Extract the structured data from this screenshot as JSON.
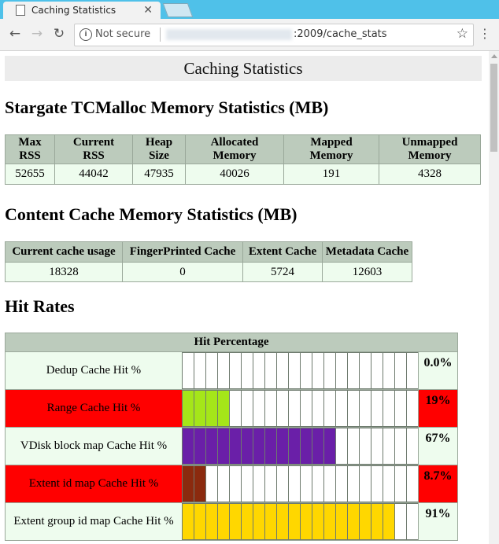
{
  "browser": {
    "tab_title": "Caching Statistics",
    "security_label": "Not secure",
    "url": ":2009/cache_stats"
  },
  "page": {
    "title": "Caching Statistics",
    "tcmalloc": {
      "heading": "Stargate TCMalloc Memory Statistics (MB)",
      "headers": [
        [
          "Max",
          "RSS"
        ],
        [
          "Current",
          "RSS"
        ],
        [
          "Heap",
          "Size"
        ],
        [
          "Allocated",
          "Memory"
        ],
        [
          "Mapped",
          "Memory"
        ],
        [
          "Unmapped",
          "Memory"
        ]
      ],
      "values": [
        "52655",
        "44042",
        "47935",
        "40026",
        "191",
        "4328"
      ]
    },
    "content_cache": {
      "heading": "Content Cache Memory Statistics (MB)",
      "headers": [
        "Current cache usage",
        "FingerPrinted Cache",
        "Extent Cache",
        "Metadata Cache"
      ],
      "values": [
        "18328",
        "0",
        "5724",
        "12603"
      ]
    },
    "hit_rates": {
      "heading": "Hit Rates",
      "column_header": "Hit Percentage",
      "rows": [
        {
          "label": "Dedup Cache Hit %",
          "percent_text": "0.0%",
          "value": 0.0,
          "filled_cells": 0,
          "bar_color": "#ffffff",
          "highlight": false
        },
        {
          "label": "Range Cache Hit %",
          "percent_text": "19%",
          "value": 19,
          "filled_cells": 4,
          "bar_color": "#a5e619",
          "highlight": true
        },
        {
          "label": "VDisk block map Cache Hit %",
          "percent_text": "67%",
          "value": 67,
          "filled_cells": 13,
          "bar_color": "#6a1fa8",
          "highlight": false
        },
        {
          "label": "Extent id map Cache Hit %",
          "percent_text": "8.7%",
          "value": 8.7,
          "filled_cells": 2,
          "bar_color": "#8b2a0e",
          "highlight": true
        },
        {
          "label": "Extent group id map Cache Hit %",
          "percent_text": "91%",
          "value": 91,
          "filled_cells": 18,
          "bar_color": "#ffd700",
          "highlight": false
        }
      ],
      "total_cells": 20
    }
  },
  "colors": {
    "header_bg": "#bccbbc",
    "cell_bg": "#eefcee",
    "alert_red": "#ff0000",
    "tab_strip": "#4fc1e9"
  }
}
